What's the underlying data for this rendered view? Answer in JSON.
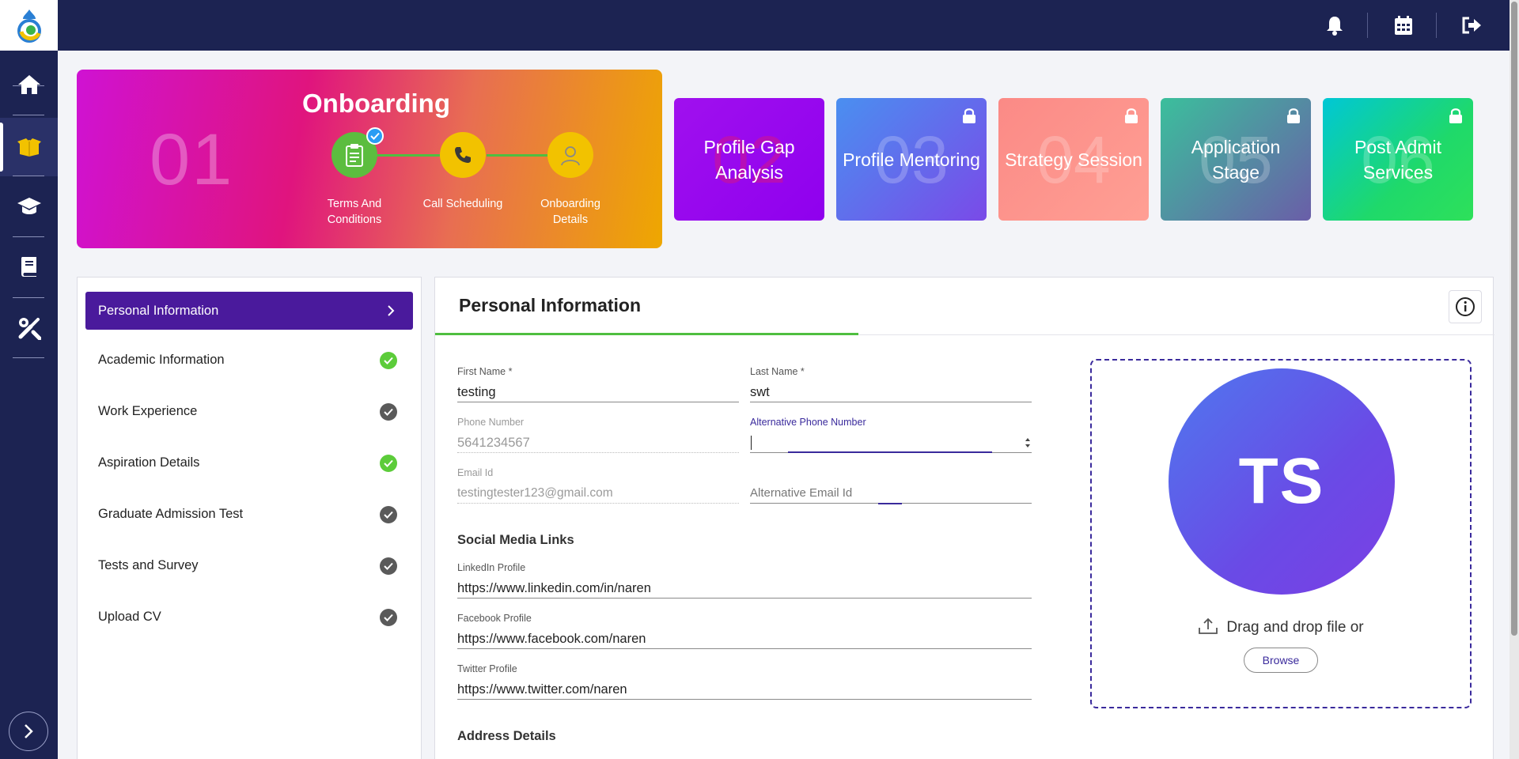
{
  "sidebar": {
    "logo": "app-logo",
    "items": [
      {
        "name": "home",
        "icon": "home-icon",
        "active": false
      },
      {
        "name": "box",
        "icon": "open-box-icon",
        "active": true
      },
      {
        "name": "school",
        "icon": "graduation-cap-icon",
        "active": false
      },
      {
        "name": "book",
        "icon": "book-icon",
        "active": false
      },
      {
        "name": "tools",
        "icon": "tools-icon",
        "active": false
      }
    ],
    "expand_icon": "chevron-right-icon"
  },
  "topbar": {
    "icons": [
      "bell-icon",
      "calendar-icon",
      "logout-icon"
    ]
  },
  "onboarding": {
    "number": "01",
    "title": "Onboarding",
    "steps": [
      {
        "label": "Terms And Conditions",
        "icon": "clipboard-icon",
        "color": "#5cbd3f",
        "done": true
      },
      {
        "label": "Call Scheduling",
        "icon": "phone-icon",
        "color": "#f2c200",
        "done": false
      },
      {
        "label": "Onboarding Details",
        "icon": "user-icon",
        "color": "#f2c200",
        "done": false
      }
    ]
  },
  "stages": [
    {
      "number": "02",
      "title": "Profile Gap Analysis",
      "locked": false
    },
    {
      "number": "03",
      "title": "Profile Mentoring",
      "locked": true
    },
    {
      "number": "04",
      "title": "Strategy Session",
      "locked": true
    },
    {
      "number": "05",
      "title": "Application Stage",
      "locked": true
    },
    {
      "number": "06",
      "title": "Post Admit Services",
      "locked": true
    }
  ],
  "menu": {
    "items": [
      {
        "label": "Personal Information",
        "status": "active"
      },
      {
        "label": "Academic Information",
        "status": "complete"
      },
      {
        "label": "Work Experience",
        "status": "done"
      },
      {
        "label": "Aspiration Details",
        "status": "complete"
      },
      {
        "label": "Graduate Admission Test",
        "status": "done"
      },
      {
        "label": "Tests and Survey",
        "status": "done"
      },
      {
        "label": "Upload CV",
        "status": "done"
      }
    ]
  },
  "form": {
    "title": "Personal Information",
    "first_name": {
      "label": "First Name *",
      "value": "testing"
    },
    "last_name": {
      "label": "Last Name *",
      "value": "swt"
    },
    "phone": {
      "label": "Phone Number",
      "value": "5641234567"
    },
    "alt_phone": {
      "label": "Alternative Phone Number",
      "value": ""
    },
    "email": {
      "label": "Email Id",
      "value": "testingtester123@gmail.com"
    },
    "alt_email": {
      "label": "",
      "placeholder": "Alternative Email Id",
      "value": ""
    },
    "social_title": "Social Media Links",
    "linkedin": {
      "label": "LinkedIn Profile",
      "value": "https://www.linkedin.com/in/naren"
    },
    "facebook": {
      "label": "Facebook Profile",
      "value": "https://www.facebook.com/naren"
    },
    "twitter": {
      "label": "Twitter Profile",
      "value": "https://www.twitter.com/naren"
    },
    "address_title": "Address Details"
  },
  "upload": {
    "initials": "TS",
    "drag_text": "Drag and drop file or",
    "browse_label": "Browse"
  },
  "colors": {
    "navy": "#1c2352",
    "purple": "#4a1a9c",
    "green": "#4fbf40",
    "yellow": "#f2c200"
  }
}
